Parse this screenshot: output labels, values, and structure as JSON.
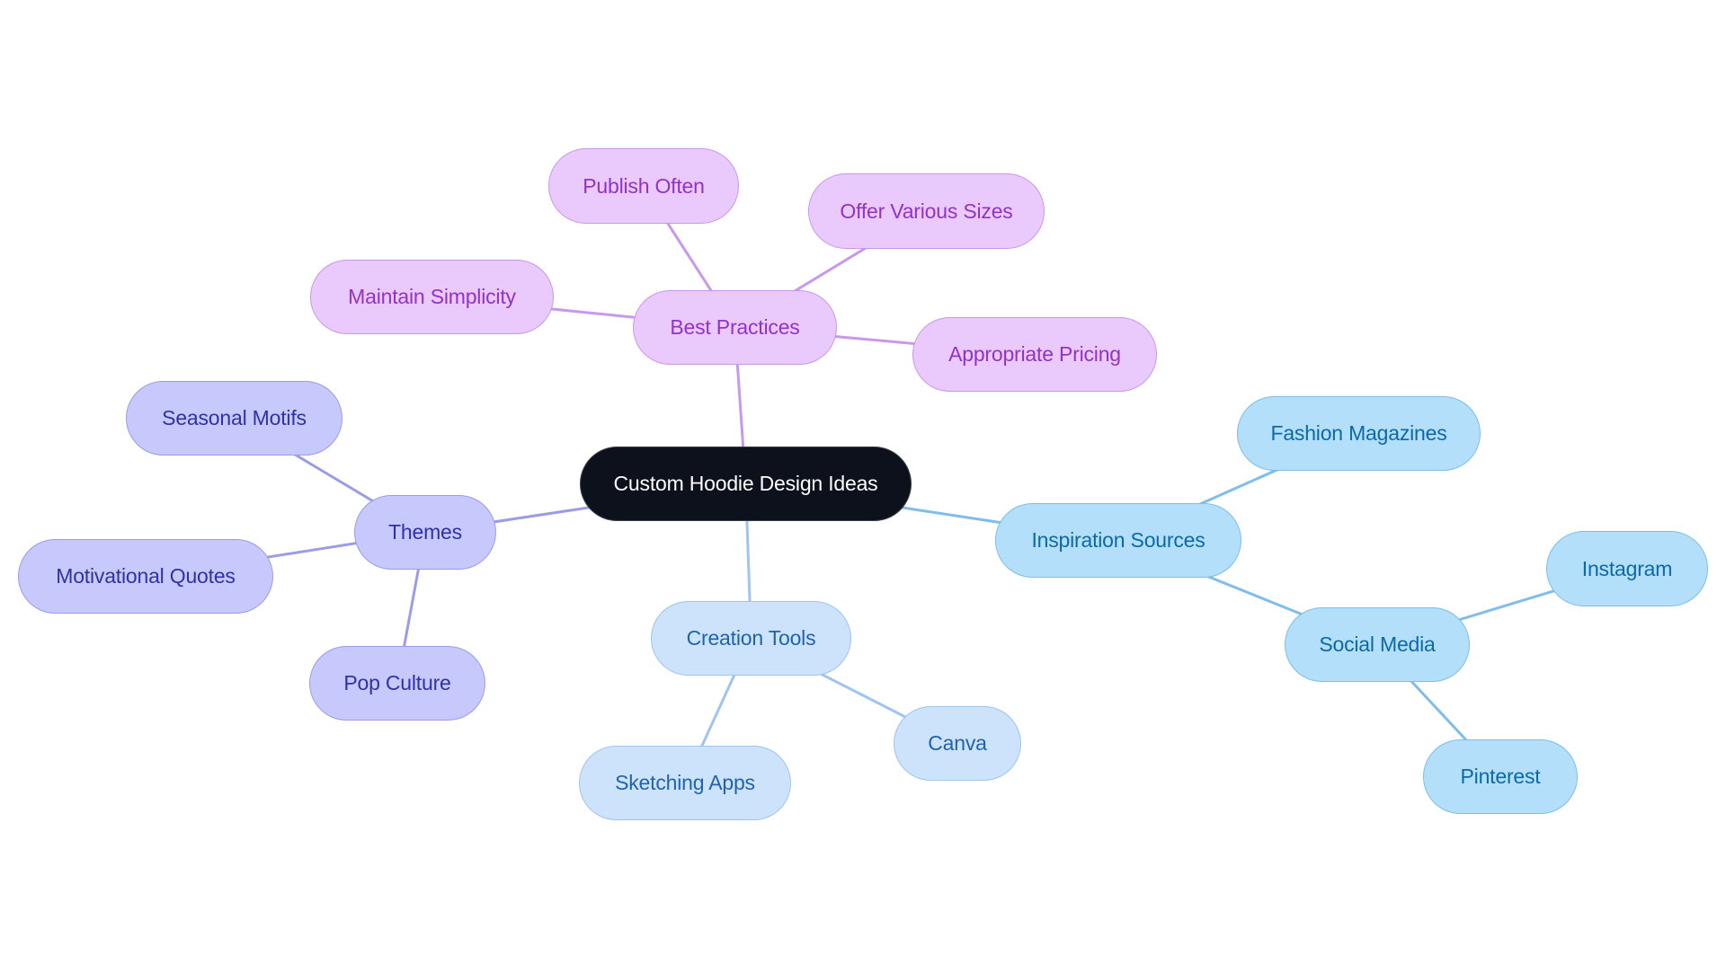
{
  "diagram": {
    "type": "mindmap",
    "root": {
      "id": "root",
      "label": "Custom Hoodie Design Ideas",
      "branch": "root"
    },
    "branches": [
      {
        "id": "best-practices",
        "label": "Best Practices",
        "branch": "purple",
        "children": [
          {
            "id": "publish-often",
            "label": "Publish Often"
          },
          {
            "id": "offer-various-sizes",
            "label": "Offer Various Sizes"
          },
          {
            "id": "maintain-simplicity",
            "label": "Maintain Simplicity"
          },
          {
            "id": "appropriate-pricing",
            "label": "Appropriate Pricing"
          }
        ]
      },
      {
        "id": "themes",
        "label": "Themes",
        "branch": "indigo",
        "children": [
          {
            "id": "seasonal-motifs",
            "label": "Seasonal Motifs"
          },
          {
            "id": "motivational-quotes",
            "label": "Motivational Quotes"
          },
          {
            "id": "pop-culture",
            "label": "Pop Culture"
          }
        ]
      },
      {
        "id": "creation-tools",
        "label": "Creation Tools",
        "branch": "light",
        "children": [
          {
            "id": "sketching-apps",
            "label": "Sketching Apps"
          },
          {
            "id": "canva",
            "label": "Canva"
          }
        ]
      },
      {
        "id": "inspiration-sources",
        "label": "Inspiration Sources",
        "branch": "sky",
        "children": [
          {
            "id": "fashion-magazines",
            "label": "Fashion Magazines"
          },
          {
            "id": "social-media",
            "label": "Social Media",
            "children": [
              {
                "id": "instagram",
                "label": "Instagram"
              },
              {
                "id": "pinterest",
                "label": "Pinterest"
              }
            ]
          }
        ]
      }
    ],
    "colors": {
      "root": {
        "fill": "#0c111b",
        "text": "#ffffff",
        "edge": "#c998ea"
      },
      "purple": {
        "fill": "#eac9fd",
        "text": "#9233c6",
        "edge": "#c998ea"
      },
      "indigo": {
        "fill": "#c7c9fc",
        "text": "#2f31aa",
        "edge": "#9a9de6"
      },
      "light": {
        "fill": "#cde3fb",
        "text": "#1f62b0",
        "edge": "#9fc4ee"
      },
      "sky": {
        "fill": "#b3dffb",
        "text": "#0b69a8",
        "edge": "#7fbdea"
      }
    }
  }
}
